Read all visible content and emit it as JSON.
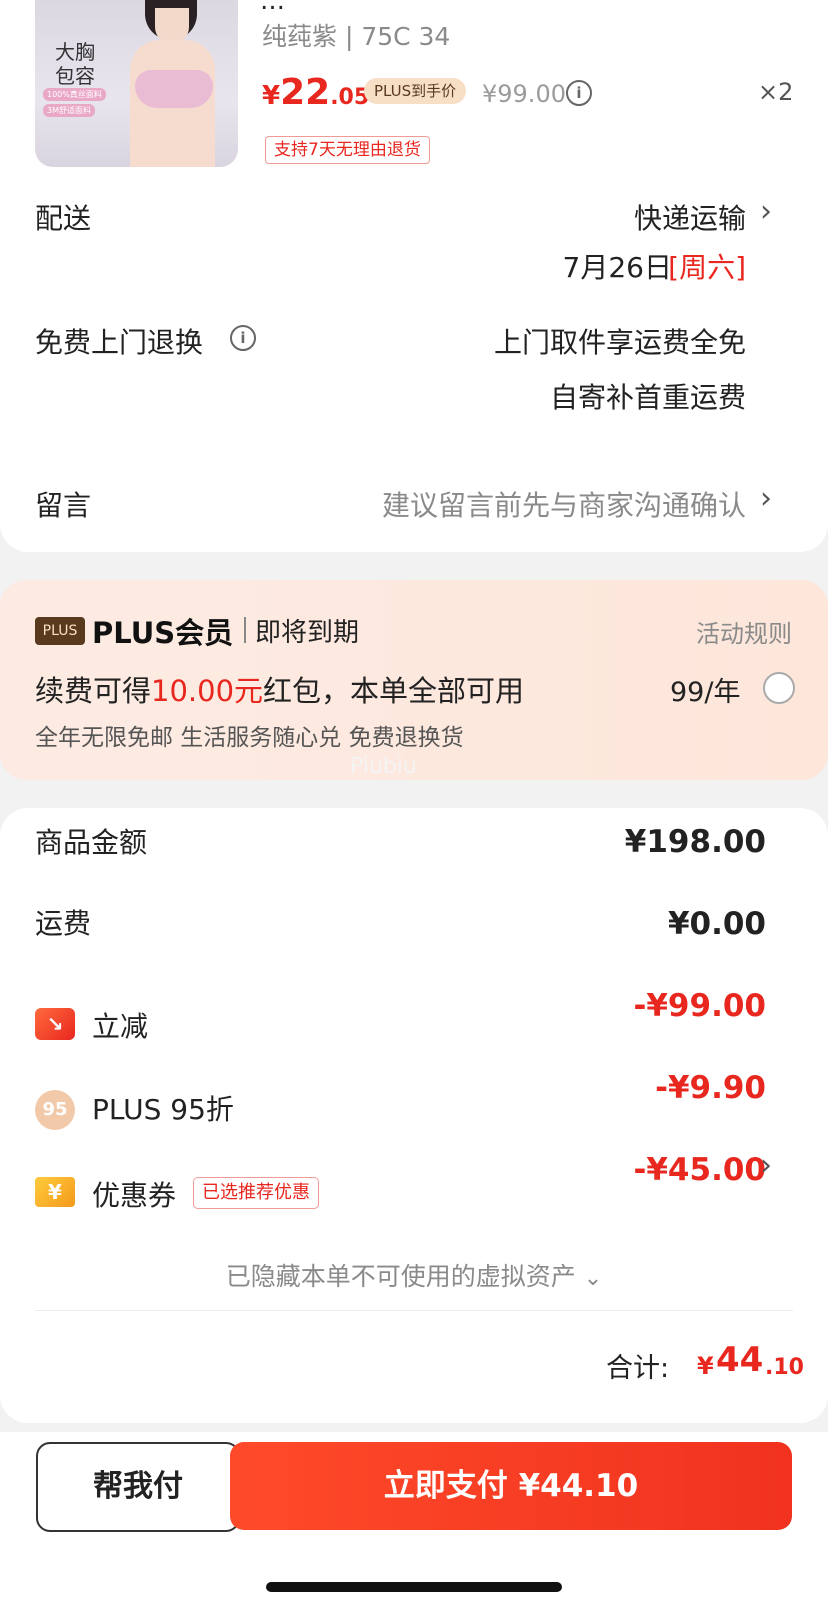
{
  "product": {
    "name": "…",
    "spec": "纯莼紫 | 75C 34",
    "image_text_main": "大胸\n包容",
    "image_text_tag1": "100%真丝面料",
    "image_text_tag2": "3M舒适面料",
    "currency": "¥",
    "price_int": "22",
    "price_dec": ".05",
    "plus_tag": "PLUS到手价",
    "original_price": "¥99.00",
    "quantity": "×2",
    "return_tag": "支持7天无理由退货"
  },
  "delivery": {
    "label": "配送",
    "method": "快递运输",
    "date": "7月26日",
    "weekday": "[周六]"
  },
  "return_service": {
    "label": "免费上门退换",
    "line1": "上门取件享运费全免",
    "line2": "自寄补首重运费"
  },
  "note": {
    "label": "留言",
    "placeholder": "建议留言前先与商家沟通确认"
  },
  "plus": {
    "logo": "PLUS",
    "title": "PLUS会员",
    "status": "即将到期",
    "rules": "活动规则",
    "offer_prefix": "续费可得",
    "offer_amount": "10.00元",
    "offer_suffix": "红包，本单全部可用",
    "price": "99/年",
    "benefits": "全年无限免邮 生活服务随心兑 免费退换货",
    "watermark": "Piubiu"
  },
  "summary": {
    "goods_label": "商品金额",
    "goods_amount": "¥198.00",
    "shipping_label": "运费",
    "shipping_amount": "¥0.00",
    "instant_icon": "↘",
    "instant_label": "立减",
    "instant_amount": "-¥99.00",
    "plus_icon": "95",
    "plus_label": "PLUS 95折",
    "plus_amount": "-¥9.90",
    "coupon_icon": "¥",
    "coupon_label": "优惠券",
    "coupon_tag": "已选推荐优惠",
    "coupon_amount": "-¥45.00",
    "hidden_assets": "已隐藏本单不可使用的虚拟资产",
    "total_label": "合计:",
    "total_yen": "¥",
    "total_int": "44",
    "total_dec": ".10"
  },
  "actions": {
    "help_pay": "帮我付",
    "pay_now": "立即支付  ¥44.10"
  }
}
